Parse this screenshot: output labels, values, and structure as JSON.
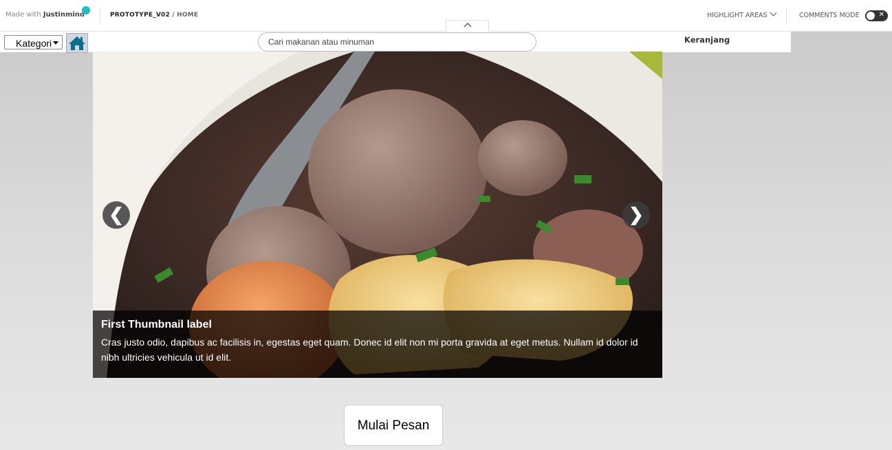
{
  "jm": {
    "made_with": "Made with",
    "brand": "Justinmind",
    "project": "PROTOTYPE_V02",
    "crumb_sep": " / ",
    "page": "HOME",
    "highlight_areas": "HIGHLIGHT AREAS",
    "comments_mode": "COMMENTS MODE",
    "toggle_x": "✕",
    "collapse_icon": "^"
  },
  "header": {
    "kategori": "Kategori",
    "search_placeholder": "Cari makanan atau minuman",
    "keranjang": "Keranjang"
  },
  "carousel": {
    "prev": "❮",
    "next": "❯",
    "caption_title": "First Thumbnail label",
    "caption_text": "Cras justo odio, dapibus ac facilisis in, egestas eget quam. Donec id elit non mi porta gravida at eget metus. Nullam id dolor id nibh ultricies vehicula ut id elit."
  },
  "cta": {
    "label": "Mulai Pesan"
  }
}
